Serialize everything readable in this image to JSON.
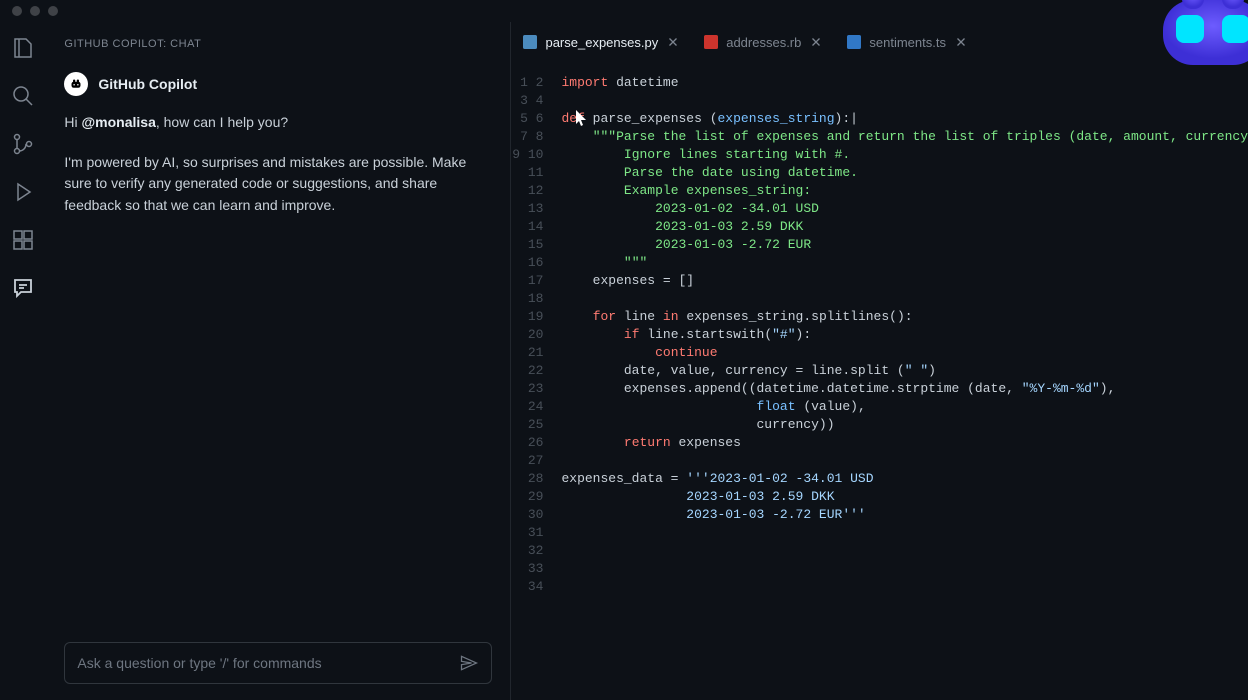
{
  "chat": {
    "panel_title": "GITHUB COPILOT: CHAT",
    "bot_name": "GitHub Copilot",
    "greeting_prefix": "Hi ",
    "mention": "@monalisa",
    "greeting_suffix": ", how can I help you?",
    "disclaimer": "I'm powered by AI, so surprises and mistakes are possible. Make sure to verify any generated code or suggestions, and share feedback so that we can learn and improve.",
    "input_placeholder": "Ask a question or type '/' for commands"
  },
  "tabs": [
    {
      "label": "parse_expenses.py",
      "active": true,
      "lang": "py"
    },
    {
      "label": "addresses.rb",
      "active": false,
      "lang": "rb"
    },
    {
      "label": "sentiments.ts",
      "active": false,
      "lang": "ts"
    }
  ],
  "code": {
    "lines": [
      [
        [
          "k",
          "import"
        ],
        [
          "",
          " datetime"
        ]
      ],
      [],
      [
        [
          "k",
          "def"
        ],
        [
          "",
          " parse_expenses ("
        ],
        [
          "p",
          "expenses_string"
        ],
        [
          "",
          ")"
        ],
        [
          "",
          ":"
        ],
        [
          "",
          "|"
        ]
      ],
      [
        [
          "",
          "    "
        ],
        [
          "d",
          "\"\"\"Parse the list of expenses and return the list of triples (date, amount, currency"
        ]
      ],
      [
        [
          "",
          "    "
        ],
        [
          "d",
          "    Ignore lines starting with #."
        ]
      ],
      [
        [
          "",
          "    "
        ],
        [
          "d",
          "    Parse the date using datetime."
        ]
      ],
      [
        [
          "",
          "    "
        ],
        [
          "d",
          "    Example expenses_string:"
        ]
      ],
      [
        [
          "",
          "    "
        ],
        [
          "d",
          "        2023-01-02 -34.01 USD"
        ]
      ],
      [
        [
          "",
          "    "
        ],
        [
          "d",
          "        2023-01-03 2.59 DKK"
        ]
      ],
      [
        [
          "",
          "    "
        ],
        [
          "d",
          "        2023-01-03 -2.72 EUR"
        ]
      ],
      [
        [
          "",
          "    "
        ],
        [
          "d",
          "    \"\"\""
        ]
      ],
      [
        [
          "",
          "    expenses = []"
        ]
      ],
      [],
      [
        [
          "",
          "    "
        ],
        [
          "k",
          "for"
        ],
        [
          "",
          " line "
        ],
        [
          "k",
          "in"
        ],
        [
          "",
          " expenses_string.splitlines():"
        ]
      ],
      [
        [
          "",
          "        "
        ],
        [
          "k",
          "if"
        ],
        [
          "",
          " line.startswith("
        ],
        [
          "s",
          "\"#\""
        ],
        [
          "",
          "):"
        ]
      ],
      [
        [
          "",
          "            "
        ],
        [
          "k",
          "continue"
        ]
      ],
      [
        [
          "",
          "        date, value, currency = line.split ("
        ],
        [
          "s",
          "\" \""
        ],
        [
          "",
          ")"
        ]
      ],
      [
        [
          "",
          "        expenses.append((datetime.datetime.strptime (date, "
        ],
        [
          "s",
          "\"%Y-%m-%d\""
        ],
        [
          "",
          "),"
        ]
      ],
      [
        [
          "",
          "                         "
        ],
        [
          "b",
          "float"
        ],
        [
          "",
          " (value),"
        ]
      ],
      [
        [
          "",
          "                         currency))"
        ]
      ],
      [
        [
          "",
          "        "
        ],
        [
          "k",
          "return"
        ],
        [
          "",
          " expenses"
        ]
      ],
      [],
      [
        [
          "",
          "expenses_data = "
        ],
        [
          "s",
          "'''2023-01-02 -34.01 USD"
        ]
      ],
      [
        [
          "",
          "                "
        ],
        [
          "s",
          "2023-01-03 2.59 DKK"
        ]
      ],
      [
        [
          "",
          "                "
        ],
        [
          "s",
          "2023-01-03 -2.72 EUR'''"
        ]
      ],
      [],
      [],
      [],
      [],
      [],
      [],
      [],
      [],
      []
    ]
  },
  "icons": {
    "files": "files-icon",
    "search": "search-icon",
    "source_control": "source-control-icon",
    "run": "run-icon",
    "extensions": "extensions-icon",
    "chat": "chat-icon"
  }
}
